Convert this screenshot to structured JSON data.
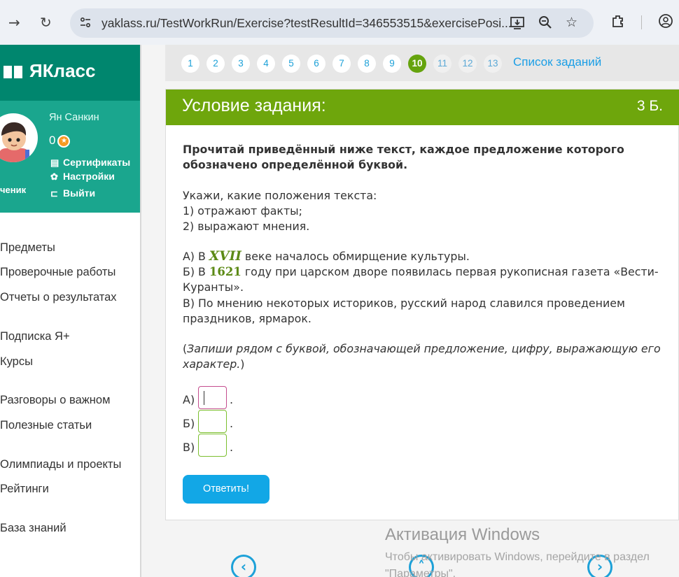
{
  "browser": {
    "url": "yaklass.ru/TestWorkRun/Exercise?testResultId=346553515&exercisePosi..."
  },
  "sidebar": {
    "logo_text": "ЯКласс",
    "user": {
      "name": "Ян Санкин",
      "coins": "0",
      "role": "ченик"
    },
    "profile_links": [
      {
        "label": "Сертификаты",
        "icon": "certificate-icon"
      },
      {
        "label": "Настройки",
        "icon": "gear-icon"
      },
      {
        "label": "Выйти",
        "icon": "logout-icon"
      }
    ],
    "menu": [
      "Предметы",
      "Проверочные работы",
      "Отчеты о результатах",
      "Подписка Я+",
      "Курсы",
      "Разговоры о важном",
      "Полезные статьи",
      "Олимпиады и проекты",
      "Рейтинги",
      "База знаний"
    ]
  },
  "pager": {
    "pages": [
      "1",
      "2",
      "3",
      "4",
      "5",
      "6",
      "7",
      "8",
      "9",
      "10",
      "11",
      "12",
      "13"
    ],
    "current": "10",
    "task_list_link": "Список заданий"
  },
  "task": {
    "header_title": "Условие задания:",
    "points": "3 Б.",
    "instruction": "Прочитай приведённый ниже текст, каждое предложение которого обозначено определённой буквой.",
    "question_intro": "Укажи, какие положения текста:",
    "question_opt1": "1) отражают факты;",
    "question_opt2": "2) выражают мнения.",
    "sentence_a_pre": "А) В ",
    "sentence_a_math": "XVII",
    "sentence_a_post": " веке началось обмирщение культуры.",
    "sentence_b_pre": "Б) В ",
    "sentence_b_math": "1621",
    "sentence_b_post": " году при царском дворе появилась первая рукописная газета «Вести-Куранты».",
    "sentence_c": "В) По мнению некоторых историков, русский народ славился проведением праздников, ярмарок.",
    "hint_open": "(",
    "hint_italic": "Запиши рядом с буквой, обозначающей предложение, цифру, выражающую его характер.",
    "hint_close": ")",
    "answers": [
      {
        "label": "А)",
        "value": ""
      },
      {
        "label": "Б)",
        "value": ""
      },
      {
        "label": "В)",
        "value": ""
      }
    ],
    "answer_dot": ".",
    "submit_label": "Ответить!"
  },
  "nav_buttons": {
    "prev": "‹",
    "up": "˄",
    "next": "›"
  },
  "windows_watermark": {
    "title": "Активация Windows",
    "subtitle": "Чтобы активировать Windows, перейдите в раздел \"Параметры\"."
  },
  "colors": {
    "logo_bg": "#00866e",
    "profile_bg": "#1aa68e",
    "task_header": "#6ea60c",
    "accent_blue": "#12a7e6",
    "active_page": "#65a30d"
  }
}
